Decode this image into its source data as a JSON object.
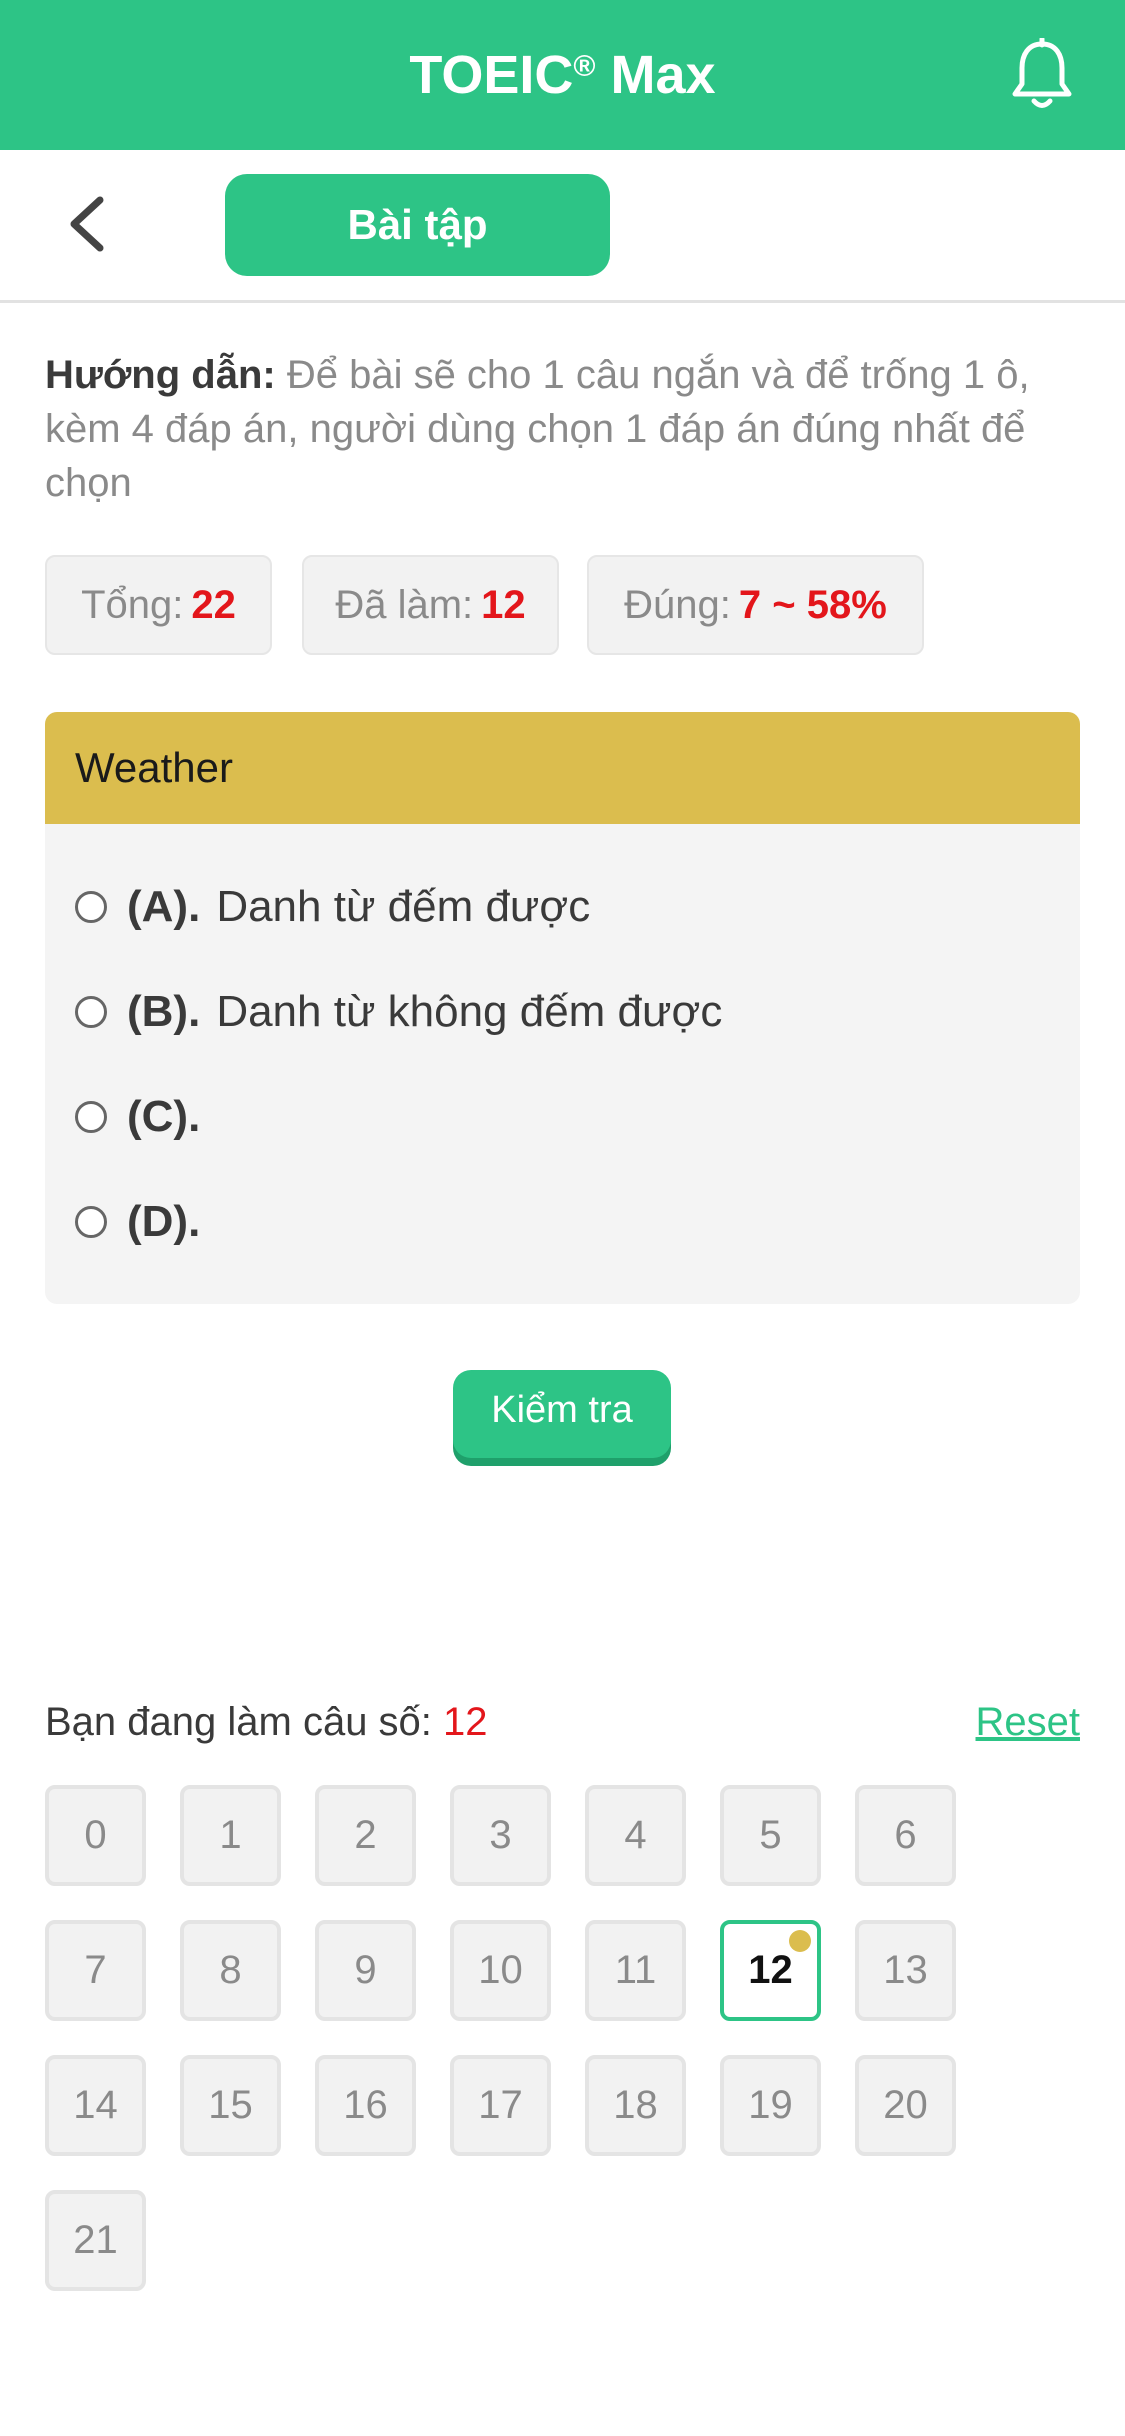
{
  "app": {
    "title": "TOEIC",
    "title_mark": "®",
    "title_suffix": "Max"
  },
  "icons": {
    "notification": "bell-icon",
    "back": "chevron-left-icon"
  },
  "nav": {
    "tab_label": "Bài tập"
  },
  "guide": {
    "label": "Hướng dẫn:",
    "text": "Để bài sẽ cho 1 câu ngắn và để trống 1 ô, kèm 4 đáp án, người dùng chọn 1 đáp án đúng nhất để chọn"
  },
  "stats": {
    "total_label": "Tổng:",
    "total_value": "22",
    "done_label": "Đã làm:",
    "done_value": "12",
    "correct_label": "Đúng:",
    "correct_value": "7 ~ 58%"
  },
  "question": {
    "title": "Weather",
    "options": [
      {
        "label": "(A).",
        "text": "Danh từ đếm được"
      },
      {
        "label": "(B).",
        "text": "Danh từ không đếm được"
      },
      {
        "label": "(C).",
        "text": ""
      },
      {
        "label": "(D).",
        "text": ""
      }
    ]
  },
  "check_button": "Kiểm tra",
  "progress": {
    "label": "Bạn đang làm câu số:",
    "current": "12",
    "reset_label": "Reset"
  },
  "question_numbers": [
    "0",
    "1",
    "2",
    "3",
    "4",
    "5",
    "6",
    "7",
    "8",
    "9",
    "10",
    "11",
    "12",
    "13",
    "14",
    "15",
    "16",
    "17",
    "18",
    "19",
    "20",
    "21"
  ],
  "colors": {
    "primary": "#2dc486",
    "accent": "#dbbd4e",
    "value_red": "#e3161b"
  }
}
